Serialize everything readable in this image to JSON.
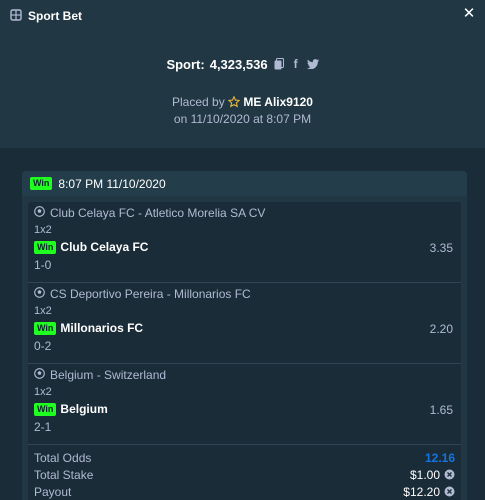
{
  "window": {
    "title": "Sport Bet"
  },
  "bet": {
    "sport_label": "Sport:",
    "sport_id": "4,323,536",
    "placed_prefix": "Placed by",
    "user": "ME Alix9120",
    "date_line": "on 11/10/2020 at 8:07 PM"
  },
  "ticket": {
    "status": "Win",
    "time": "8:07 PM 11/10/2020",
    "legs": [
      {
        "match": "Club Celaya FC - Atletico Morelia SA CV",
        "market": "1x2",
        "status": "Win",
        "pick": "Club Celaya FC",
        "odds": "3.35",
        "score": "1-0"
      },
      {
        "match": "CS Deportivo Pereira - Millonarios FC",
        "market": "1x2",
        "status": "Win",
        "pick": "Millonarios FC",
        "odds": "2.20",
        "score": "0-2"
      },
      {
        "match": "Belgium - Switzerland",
        "market": "1x2",
        "status": "Win",
        "pick": "Belgium",
        "odds": "1.65",
        "score": "2-1"
      }
    ],
    "summary": {
      "total_odds_label": "Total Odds",
      "total_odds": "12.16",
      "total_stake_label": "Total Stake",
      "total_stake": "$1.00",
      "payout_label": "Payout",
      "payout": "$12.20"
    }
  },
  "colors": {
    "accent_blue": "#1475e1",
    "win_green": "#1fff20",
    "bg": "#1a2c38",
    "panel": "#213743"
  }
}
